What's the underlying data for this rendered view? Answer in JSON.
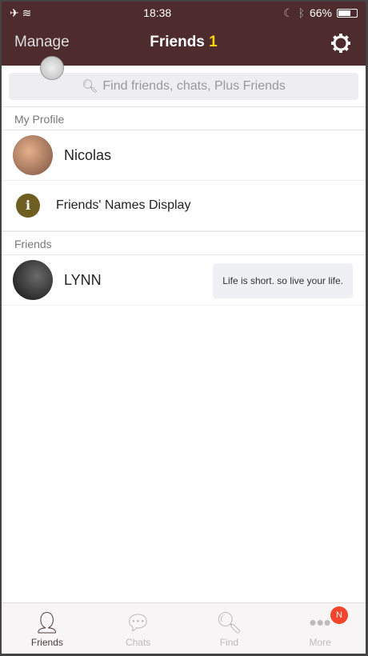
{
  "status": {
    "time": "18:38",
    "battery": "66%",
    "battery_level": 0.66
  },
  "header": {
    "manage": "Manage",
    "title": "Friends",
    "count": "1"
  },
  "search": {
    "placeholder": "Find friends, chats, Plus Friends"
  },
  "my_profile": {
    "label": "My Profile",
    "name": "Nicolas"
  },
  "names_display": "Friends' Names Display",
  "friends": {
    "label": "Friends",
    "items": [
      {
        "name": "LYNN",
        "status": "Life is short.  so live your life."
      }
    ]
  },
  "tabs": [
    {
      "label": "Friends"
    },
    {
      "label": "Chats"
    },
    {
      "label": "Find"
    },
    {
      "label": "More",
      "badge": "N"
    }
  ]
}
